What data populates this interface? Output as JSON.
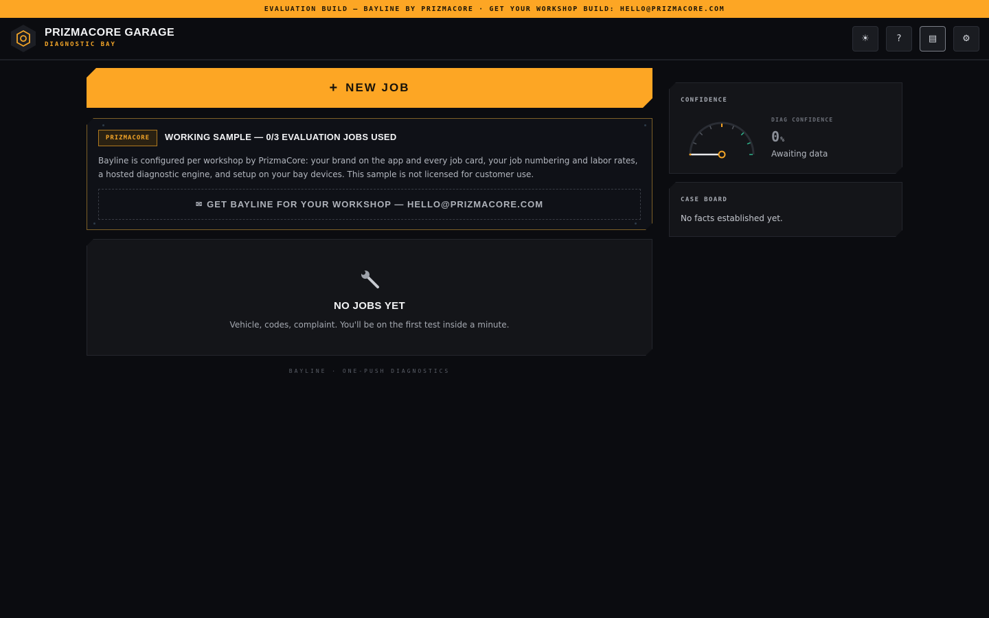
{
  "banner": {
    "text": "EVALUATION BUILD — BAYLINE BY PRIZMACORE · GET YOUR WORKSHOP BUILD: HELLO@PRIZMACORE.COM"
  },
  "header": {
    "title": "PRIZMACORE GARAGE",
    "subtitle": "DIAGNOSTIC BAY",
    "buttons": [
      {
        "icon": "sun-icon",
        "glyph": "☀"
      },
      {
        "icon": "help-icon",
        "glyph": "?"
      },
      {
        "icon": "list-icon",
        "glyph": "▤"
      },
      {
        "icon": "gear-icon",
        "glyph": "⚙"
      }
    ]
  },
  "new_job": {
    "label": "NEW JOB",
    "plus": "+"
  },
  "sample": {
    "badge": "PRIZMACORE",
    "title": "WORKING SAMPLE — 0/3 EVALUATION JOBS USED",
    "description": "Bayline is configured per workshop by PrizmaCore: your brand on the app and every job card, your job numbering and labor rates, a hosted diagnostic engine, and setup on your bay devices. This sample is not licensed for customer use.",
    "cta_icon": "✉",
    "cta": "GET BAYLINE FOR YOUR WORKSHOP — HELLO@PRIZMACORE.COM"
  },
  "empty": {
    "icon": "wrench-icon",
    "title": "NO JOBS YET",
    "subtitle": "Vehicle, codes, complaint. You'll be on the first test inside a minute."
  },
  "footer": {
    "text": "BAYLINE · ONE-PUSH DIAGNOSTICS"
  },
  "confidence": {
    "label": "CONFIDENCE",
    "diag_label": "DIAG CONFIDENCE",
    "value": "0",
    "unit": "%",
    "level": 0,
    "status": "Awaiting data"
  },
  "case_board": {
    "label": "CASE BOARD",
    "text": "No facts established yet."
  },
  "colors": {
    "accent": "#fda624",
    "background": "#0b0c10",
    "panel": "#141519",
    "gauge_green": "#2fb58c"
  }
}
